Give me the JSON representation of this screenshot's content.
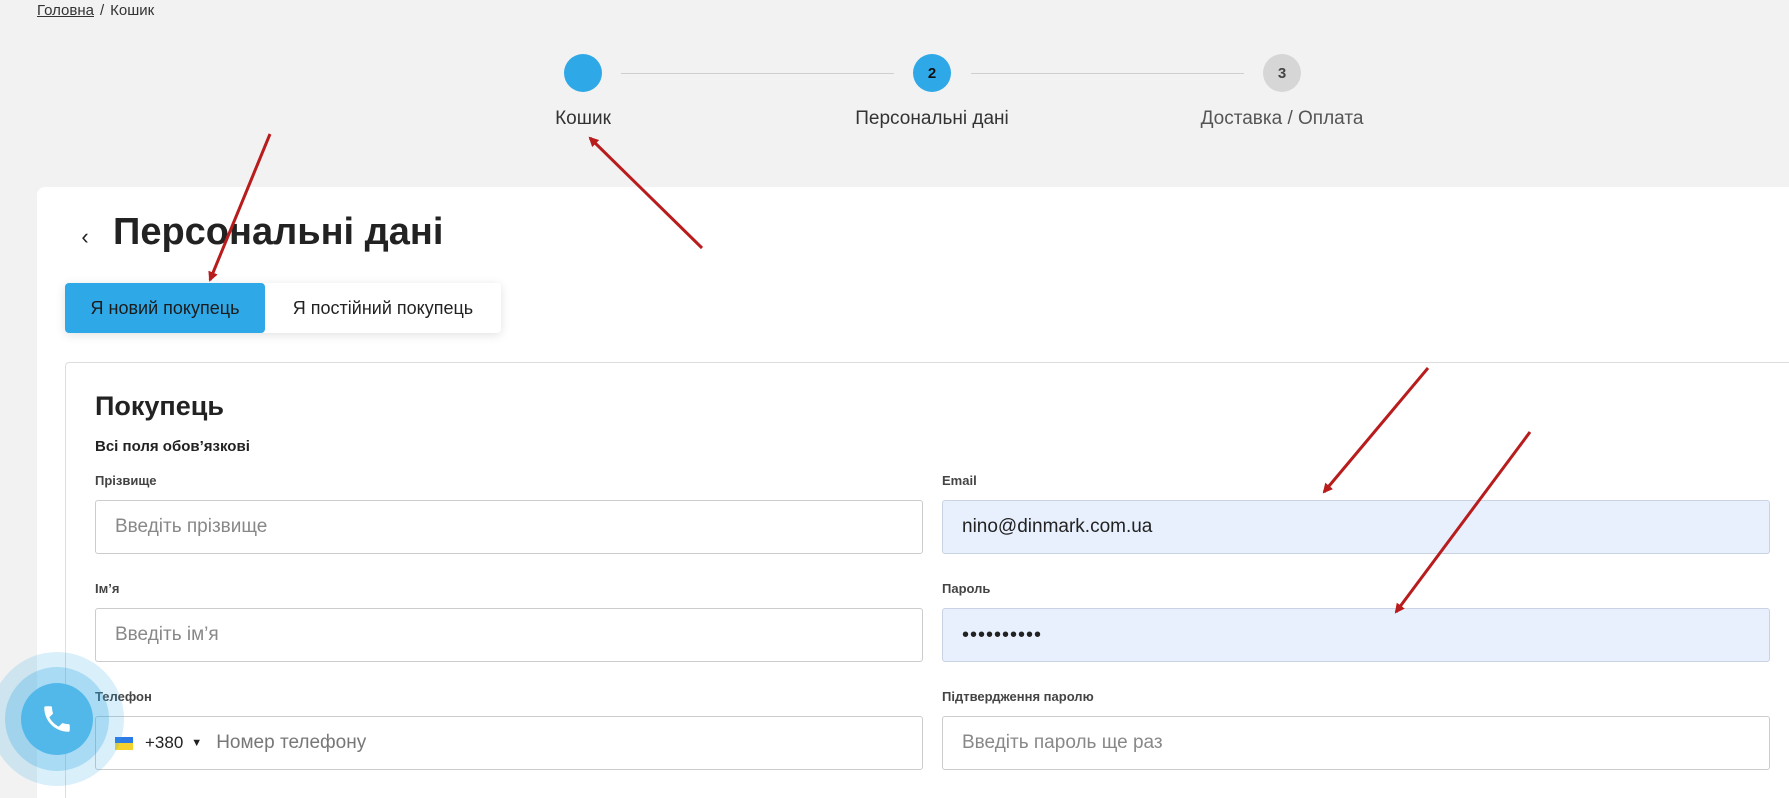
{
  "breadcrumb": {
    "home": "Головна",
    "separator": "/",
    "current": "Кошик"
  },
  "steps": [
    {
      "number": "",
      "label": "Кошик"
    },
    {
      "number": "2",
      "label": "Персональні дані"
    },
    {
      "number": "3",
      "label": "Доставка / Оплата"
    }
  ],
  "page": {
    "back": "‹",
    "title": "Персональні дані",
    "tabs": {
      "new_buyer": "Я новий покупець",
      "returning_buyer": "Я постійний покупець"
    }
  },
  "form": {
    "title": "Покупець",
    "note": "Всі поля обов’язкові",
    "surname": {
      "label": "Прізвище",
      "placeholder": "Введіть прізвище"
    },
    "email": {
      "label": "Email",
      "value": "nino@dinmark.com.ua"
    },
    "name": {
      "label": "Ім’я",
      "placeholder": "Введіть ім’я"
    },
    "password": {
      "label": "Пароль",
      "value": "••••••••••"
    },
    "phone": {
      "label": "Телефон",
      "code": "+380",
      "placeholder": "Номер телефону"
    },
    "confirm": {
      "label": "Підтвердження паролю",
      "placeholder": "Введіть пароль ще раз"
    }
  },
  "colors": {
    "accent": "#2ea8e6",
    "autofill": "#e8f0fe",
    "annotation": "#b81c1c"
  },
  "icons": {
    "call": "phone-icon",
    "flag": "ukraine-flag-icon"
  }
}
